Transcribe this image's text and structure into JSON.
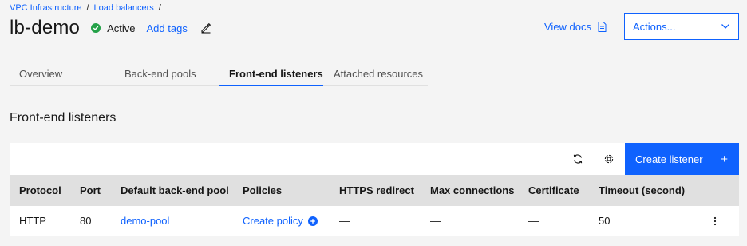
{
  "breadcrumb": {
    "items": [
      "VPC Infrastructure",
      "Load balancers"
    ],
    "separator": "/"
  },
  "header": {
    "title": "lb-demo",
    "status": "Active",
    "add_tags": "Add tags",
    "view_docs": "View docs",
    "actions": "Actions..."
  },
  "tabs": [
    {
      "label": "Overview",
      "active": false
    },
    {
      "label": "Back-end pools",
      "active": false
    },
    {
      "label": "Front-end listeners",
      "active": true
    },
    {
      "label": "Attached resources",
      "active": false
    }
  ],
  "section_title": "Front-end listeners",
  "toolbar": {
    "create_label": "Create listener",
    "create_icon": "+"
  },
  "table": {
    "columns": [
      "Protocol",
      "Port",
      "Default back-end pool",
      "Policies",
      "HTTPS redirect",
      "Max connections",
      "Certificate",
      "Timeout (second)"
    ],
    "rows": [
      {
        "protocol": "HTTP",
        "port": "80",
        "pool": "demo-pool",
        "policies": "Create policy",
        "https_redirect": "—",
        "max_connections": "—",
        "certificate": "—",
        "timeout": "50"
      }
    ]
  },
  "colors": {
    "accent": "#0f62fe",
    "status_active": "#24a148",
    "background": "#f4f4f4",
    "header_bg": "#e0e0e0"
  },
  "icons": [
    "checkmark-filled-icon",
    "edit-icon",
    "document-icon",
    "chevron-down-icon",
    "refresh-icon",
    "settings-icon",
    "add-icon",
    "add-filled-icon",
    "overflow-menu-icon"
  ]
}
